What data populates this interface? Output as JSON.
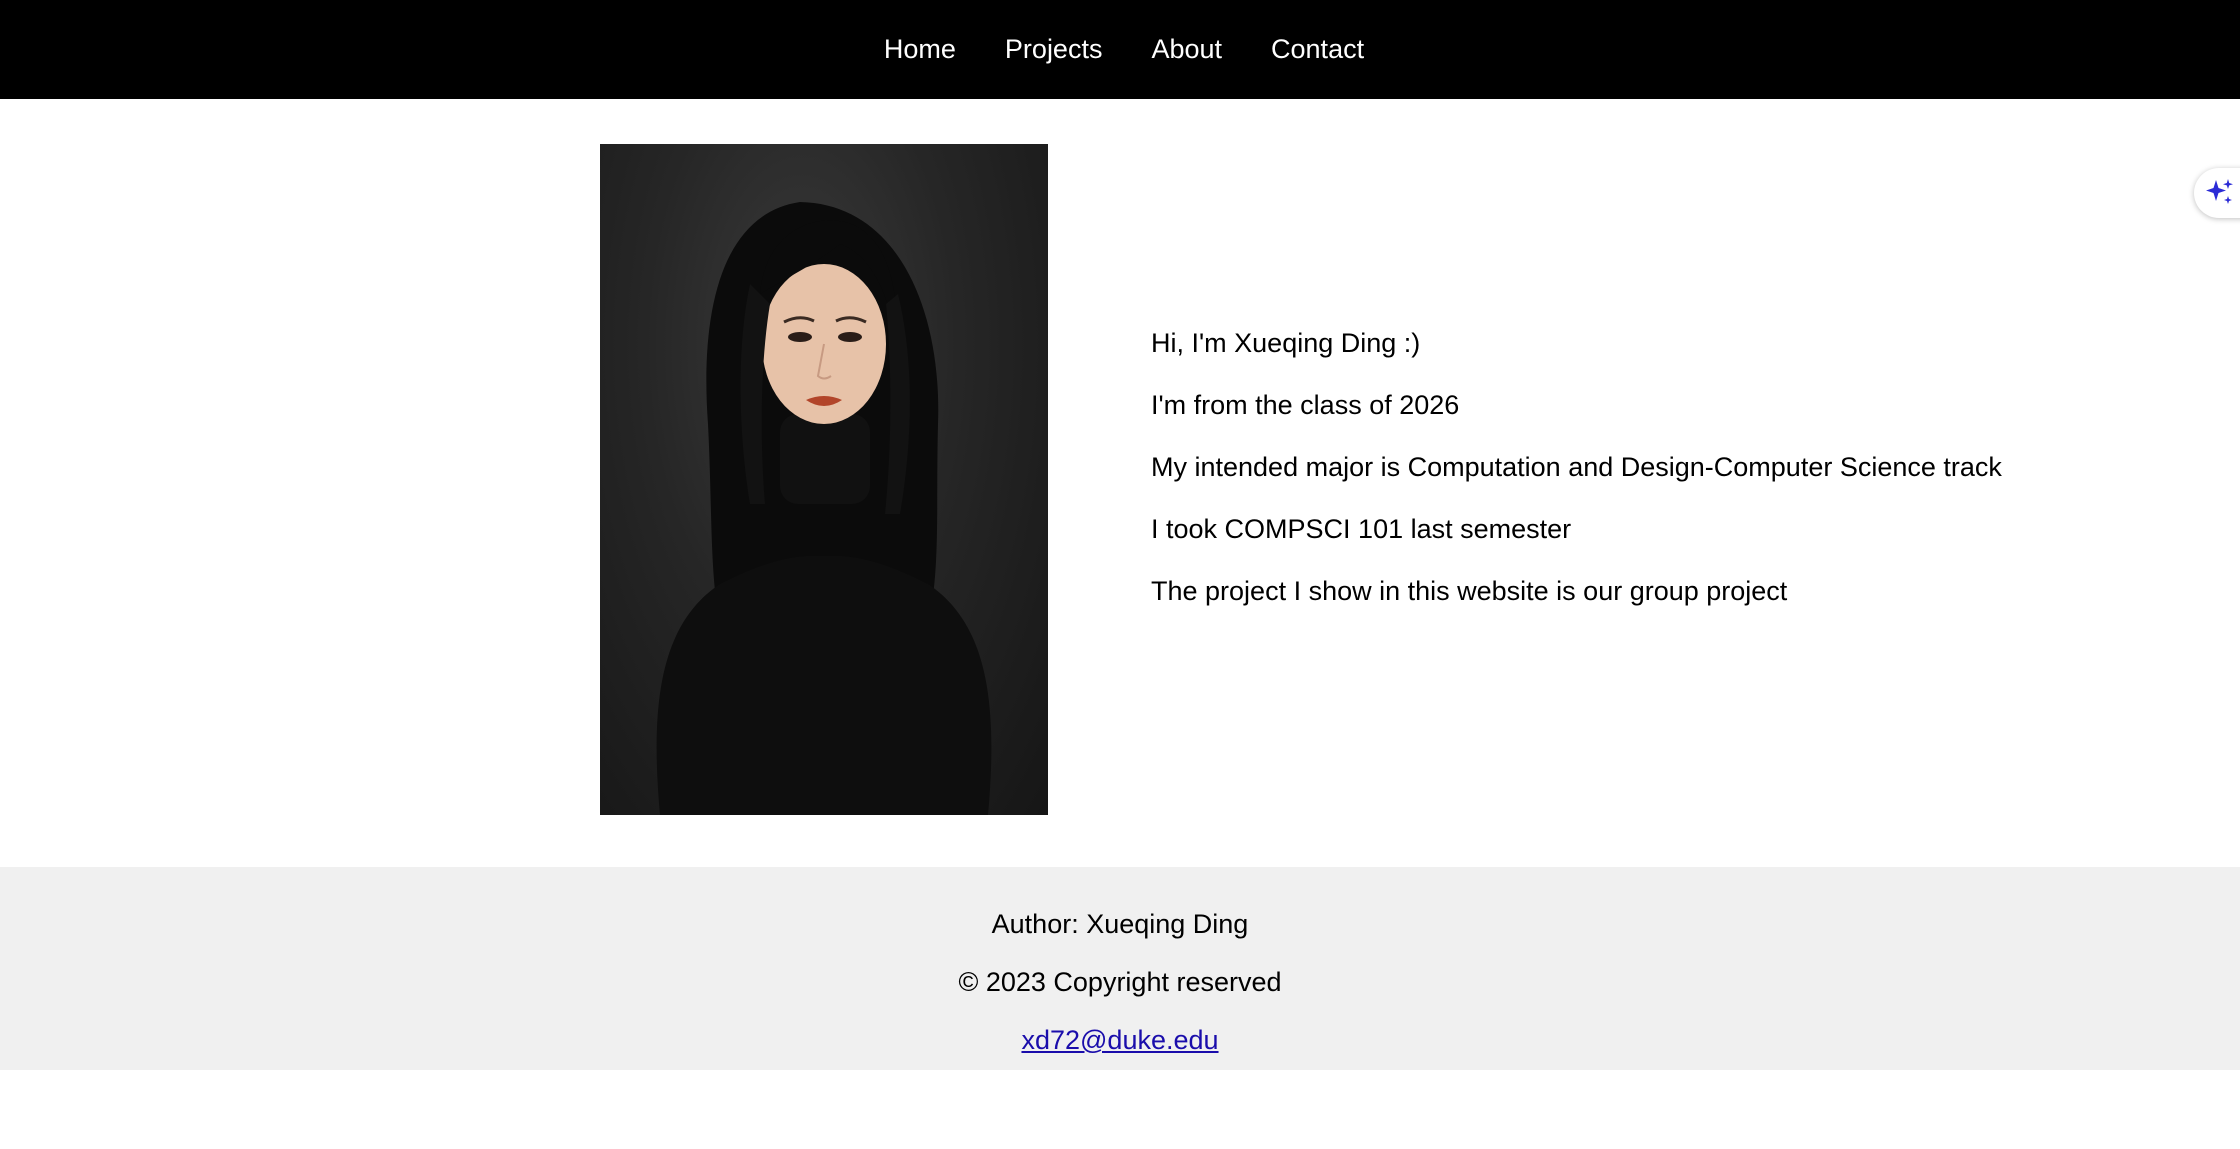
{
  "nav": {
    "items": [
      {
        "label": "Home"
      },
      {
        "label": "Projects"
      },
      {
        "label": "About"
      },
      {
        "label": "Contact"
      }
    ]
  },
  "profile": {
    "photo_icon": "portrait-photo"
  },
  "bio": {
    "lines": [
      "Hi, I'm Xueqing Ding :)",
      "I'm from the class of 2026",
      "My intended major is Computation and Design-Computer Science track",
      "I took COMPSCI 101 last semester",
      "The project I show in this website is our group project"
    ]
  },
  "footer": {
    "author": "Author: Xueqing Ding",
    "copyright": "© 2023 Copyright reserved",
    "email": "xd72@duke.edu"
  },
  "colors": {
    "nav_bg": "#000000",
    "footer_bg": "#f0f0f0",
    "link": "#1a0dab",
    "sparkle": "#2b2bd6"
  },
  "floating_button": {
    "icon": "sparkle-icon"
  }
}
